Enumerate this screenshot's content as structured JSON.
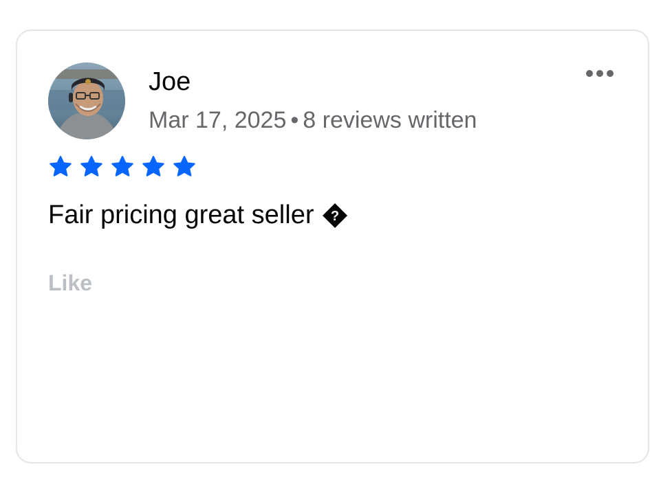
{
  "review": {
    "reviewer_name": "Joe",
    "date": "Mar 17, 2025",
    "separator": "•",
    "reviews_written": "8 reviews written",
    "rating": 5,
    "rating_max": 5,
    "text": "Fair pricing great seller",
    "unknown_glyph": "?",
    "like_label": "Like"
  },
  "icons": {
    "more": "more-horizontal-icon",
    "star": "star-filled-icon",
    "unknown_char": "replacement-character-icon"
  },
  "colors": {
    "star": "#0866ff",
    "name": "#050505",
    "meta": "#65676b",
    "like": "#bcc0c4",
    "border": "#e3e5e8"
  }
}
